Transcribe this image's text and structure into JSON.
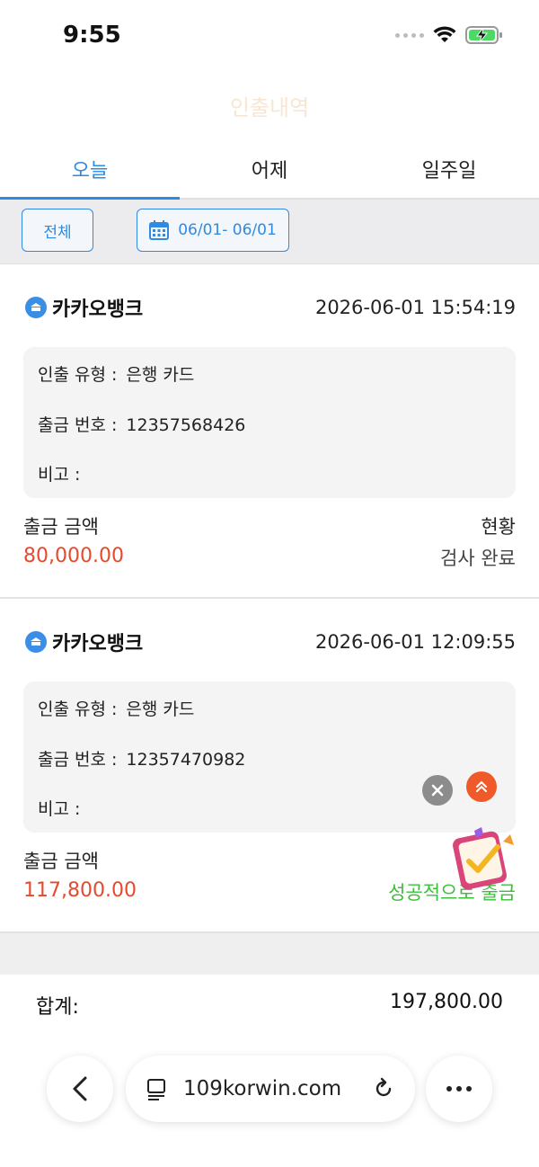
{
  "status_bar": {
    "time": "9:55"
  },
  "page_title": "인출내역",
  "tabs": [
    {
      "label": "오늘",
      "active": true
    },
    {
      "label": "어제",
      "active": false
    },
    {
      "label": "일주일",
      "active": false
    }
  ],
  "filter": {
    "all_label": "전체",
    "date_range": "06/01- 06/01"
  },
  "records": [
    {
      "bank": "카카오뱅크",
      "datetime": "2026-06-01 15:54:19",
      "type_label": "인출 유형 :",
      "type_value": "은행 카드",
      "number_label": "출금 번호 :",
      "number_value": "12357568426",
      "memo_label": "비고 :",
      "amount_label": "출금 금액",
      "amount_value": "80,000.00",
      "status_label": "현황",
      "status_value": "검사 완료"
    },
    {
      "bank": "카카오뱅크",
      "datetime": "2026-06-01 12:09:55",
      "type_label": "인출 유형 :",
      "type_value": "은행 카드",
      "number_label": "출금 번호 :",
      "number_value": "12357470982",
      "memo_label": "비고 :",
      "amount_label": "출금 금액",
      "amount_value": "117,800.00",
      "status_label": "현황",
      "status_value": "성공적으로 출금"
    }
  ],
  "total": {
    "label": "합계:",
    "value": "197,800.00"
  },
  "browser": {
    "url": "109korwin.com"
  },
  "colors": {
    "accent": "#2f8ae0",
    "amount": "#e64a2e",
    "success": "#3bbf3b"
  }
}
